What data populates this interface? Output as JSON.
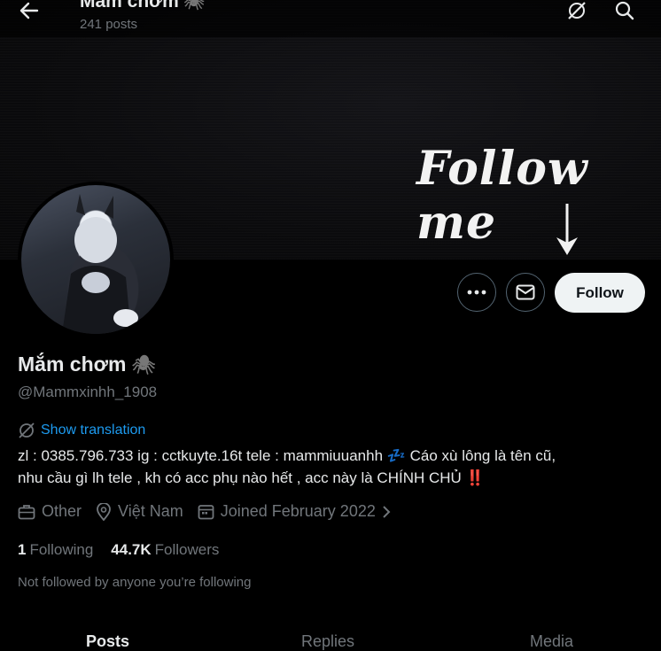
{
  "banner": {
    "text": "Follow me"
  },
  "header": {
    "back_icon": "arrow-left-icon",
    "title": "Mắm chơm",
    "title_emoji": "🕷",
    "posts_count": "241 posts",
    "icons": [
      "grok-icon",
      "search-icon"
    ]
  },
  "profile": {
    "display_name": "Mắm chơm",
    "name_emoji": "🕷",
    "handle": "@Mammxinhh_1908",
    "show_translation": "Show translation",
    "bio_line1": "zl : 0385.796.733 ig : cctkuyte.16t tele : mammiuuanhh 💤 Cáo xù lông là tên cũ,",
    "bio_line2": "nhu cầu gì lh tele , kh có acc phụ nào hết , acc này là CHÍNH CHỦ ‼️",
    "category": "Other",
    "location": "Việt Nam",
    "joined": "Joined February 2022",
    "following_count": "1",
    "following_label": "Following",
    "followers_count": "44.7K",
    "followers_label": "Followers",
    "not_followed_note": "Not followed by anyone you’re following"
  },
  "actions": {
    "more_icon": "more-dots-icon",
    "message_icon": "envelope-icon",
    "follow_label": "Follow"
  },
  "tabs": [
    {
      "label": "Posts"
    },
    {
      "label": "Replies"
    },
    {
      "label": "Media"
    }
  ],
  "colors": {
    "background": "#000000",
    "text_primary": "#e7e9ea",
    "text_secondary": "#71767b",
    "accent": "#1d9bf0",
    "follow_button_bg": "#eff3f4"
  }
}
